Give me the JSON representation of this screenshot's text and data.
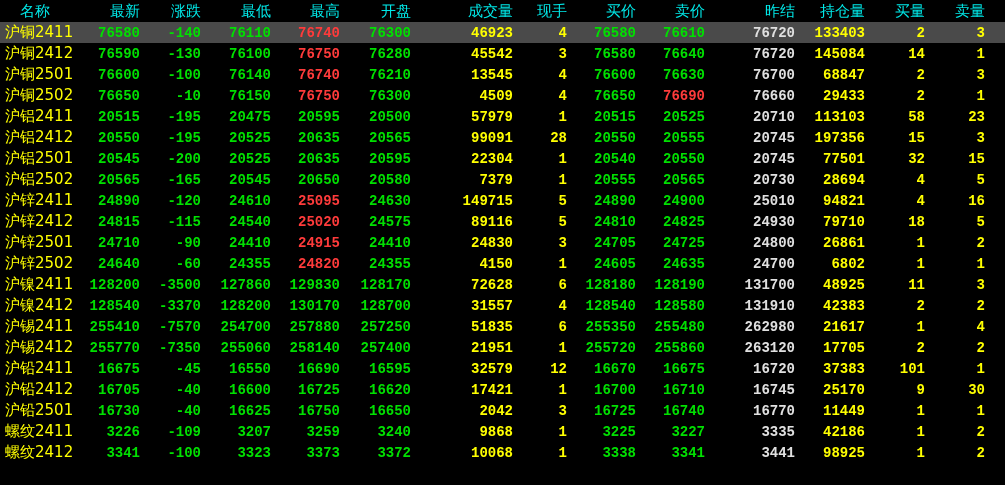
{
  "table": {
    "columns": [
      {
        "label": "名称",
        "kind": "name"
      },
      {
        "label": "最新",
        "kind": "price"
      },
      {
        "label": "涨跌",
        "kind": "price"
      },
      {
        "label": "最低",
        "kind": "price"
      },
      {
        "label": "最高",
        "kind": "price"
      },
      {
        "label": "开盘",
        "kind": "price"
      },
      {
        "label": "成交量",
        "kind": "volume"
      },
      {
        "label": "现手",
        "kind": "volume"
      },
      {
        "label": "买价",
        "kind": "price"
      },
      {
        "label": "卖价",
        "kind": "price"
      },
      {
        "label": "昨结",
        "kind": "settle"
      },
      {
        "label": "持仓量",
        "kind": "volume"
      },
      {
        "label": "买量",
        "kind": "volume"
      },
      {
        "label": "卖量",
        "kind": "volume"
      }
    ],
    "rows": [
      {
        "selected": true,
        "cells": [
          "沪铜2411",
          {
            "text": "76580",
            "color": "#00e000"
          },
          {
            "text": "-140",
            "color": "#00e000"
          },
          {
            "text": "76110",
            "color": "#00e000"
          },
          {
            "text": "76740",
            "color": "#ff3b3b"
          },
          {
            "text": "76300",
            "color": "#00e000"
          },
          "46923",
          "4",
          {
            "text": "76580",
            "color": "#00e000"
          },
          {
            "text": "76610",
            "color": "#00e000"
          },
          "76720",
          "133403",
          "2",
          "3"
        ]
      },
      {
        "selected": false,
        "cells": [
          "沪铜2412",
          {
            "text": "76590",
            "color": "#00e000"
          },
          {
            "text": "-130",
            "color": "#00e000"
          },
          {
            "text": "76100",
            "color": "#00e000"
          },
          {
            "text": "76750",
            "color": "#ff3b3b"
          },
          {
            "text": "76280",
            "color": "#00e000"
          },
          "45542",
          "3",
          {
            "text": "76580",
            "color": "#00e000"
          },
          {
            "text": "76640",
            "color": "#00e000"
          },
          "76720",
          "145084",
          "14",
          "1"
        ]
      },
      {
        "selected": false,
        "cells": [
          "沪铜2501",
          {
            "text": "76600",
            "color": "#00e000"
          },
          {
            "text": "-100",
            "color": "#00e000"
          },
          {
            "text": "76140",
            "color": "#00e000"
          },
          {
            "text": "76740",
            "color": "#ff3b3b"
          },
          {
            "text": "76210",
            "color": "#00e000"
          },
          "13545",
          "4",
          {
            "text": "76600",
            "color": "#00e000"
          },
          {
            "text": "76630",
            "color": "#00e000"
          },
          "76700",
          "68847",
          "2",
          "3"
        ]
      },
      {
        "selected": false,
        "cells": [
          "沪铜2502",
          {
            "text": "76650",
            "color": "#00e000"
          },
          {
            "text": "-10",
            "color": "#00e000"
          },
          {
            "text": "76150",
            "color": "#00e000"
          },
          {
            "text": "76750",
            "color": "#ff3b3b"
          },
          {
            "text": "76300",
            "color": "#00e000"
          },
          "4509",
          "4",
          {
            "text": "76650",
            "color": "#00e000"
          },
          {
            "text": "76690",
            "color": "#ff3b3b"
          },
          "76660",
          "29433",
          "2",
          "1"
        ]
      },
      {
        "selected": false,
        "cells": [
          "沪铝2411",
          {
            "text": "20515",
            "color": "#00e000"
          },
          {
            "text": "-195",
            "color": "#00e000"
          },
          {
            "text": "20475",
            "color": "#00e000"
          },
          {
            "text": "20595",
            "color": "#00e000"
          },
          {
            "text": "20500",
            "color": "#00e000"
          },
          "57979",
          "1",
          {
            "text": "20515",
            "color": "#00e000"
          },
          {
            "text": "20525",
            "color": "#00e000"
          },
          "20710",
          "113103",
          "58",
          "23"
        ]
      },
      {
        "selected": false,
        "cells": [
          "沪铝2412",
          {
            "text": "20550",
            "color": "#00e000"
          },
          {
            "text": "-195",
            "color": "#00e000"
          },
          {
            "text": "20525",
            "color": "#00e000"
          },
          {
            "text": "20635",
            "color": "#00e000"
          },
          {
            "text": "20565",
            "color": "#00e000"
          },
          "99091",
          "28",
          {
            "text": "20550",
            "color": "#00e000"
          },
          {
            "text": "20555",
            "color": "#00e000"
          },
          "20745",
          "197356",
          "15",
          "3"
        ]
      },
      {
        "selected": false,
        "cells": [
          "沪铝2501",
          {
            "text": "20545",
            "color": "#00e000"
          },
          {
            "text": "-200",
            "color": "#00e000"
          },
          {
            "text": "20525",
            "color": "#00e000"
          },
          {
            "text": "20635",
            "color": "#00e000"
          },
          {
            "text": "20595",
            "color": "#00e000"
          },
          "22304",
          "1",
          {
            "text": "20540",
            "color": "#00e000"
          },
          {
            "text": "20550",
            "color": "#00e000"
          },
          "20745",
          "77501",
          "32",
          "15"
        ]
      },
      {
        "selected": false,
        "cells": [
          "沪铝2502",
          {
            "text": "20565",
            "color": "#00e000"
          },
          {
            "text": "-165",
            "color": "#00e000"
          },
          {
            "text": "20545",
            "color": "#00e000"
          },
          {
            "text": "20650",
            "color": "#00e000"
          },
          {
            "text": "20580",
            "color": "#00e000"
          },
          "7379",
          "1",
          {
            "text": "20555",
            "color": "#00e000"
          },
          {
            "text": "20565",
            "color": "#00e000"
          },
          "20730",
          "28694",
          "4",
          "5"
        ]
      },
      {
        "selected": false,
        "cells": [
          "沪锌2411",
          {
            "text": "24890",
            "color": "#00e000"
          },
          {
            "text": "-120",
            "color": "#00e000"
          },
          {
            "text": "24610",
            "color": "#00e000"
          },
          {
            "text": "25095",
            "color": "#ff3b3b"
          },
          {
            "text": "24630",
            "color": "#00e000"
          },
          "149715",
          "5",
          {
            "text": "24890",
            "color": "#00e000"
          },
          {
            "text": "24900",
            "color": "#00e000"
          },
          "25010",
          "94821",
          "4",
          "16"
        ]
      },
      {
        "selected": false,
        "cells": [
          "沪锌2412",
          {
            "text": "24815",
            "color": "#00e000"
          },
          {
            "text": "-115",
            "color": "#00e000"
          },
          {
            "text": "24540",
            "color": "#00e000"
          },
          {
            "text": "25020",
            "color": "#ff3b3b"
          },
          {
            "text": "24575",
            "color": "#00e000"
          },
          "89116",
          "5",
          {
            "text": "24810",
            "color": "#00e000"
          },
          {
            "text": "24825",
            "color": "#00e000"
          },
          "24930",
          "79710",
          "18",
          "5"
        ]
      },
      {
        "selected": false,
        "cells": [
          "沪锌2501",
          {
            "text": "24710",
            "color": "#00e000"
          },
          {
            "text": "-90",
            "color": "#00e000"
          },
          {
            "text": "24410",
            "color": "#00e000"
          },
          {
            "text": "24915",
            "color": "#ff3b3b"
          },
          {
            "text": "24410",
            "color": "#00e000"
          },
          "24830",
          "3",
          {
            "text": "24705",
            "color": "#00e000"
          },
          {
            "text": "24725",
            "color": "#00e000"
          },
          "24800",
          "26861",
          "1",
          "2"
        ]
      },
      {
        "selected": false,
        "cells": [
          "沪锌2502",
          {
            "text": "24640",
            "color": "#00e000"
          },
          {
            "text": "-60",
            "color": "#00e000"
          },
          {
            "text": "24355",
            "color": "#00e000"
          },
          {
            "text": "24820",
            "color": "#ff3b3b"
          },
          {
            "text": "24355",
            "color": "#00e000"
          },
          "4150",
          "1",
          {
            "text": "24605",
            "color": "#00e000"
          },
          {
            "text": "24635",
            "color": "#00e000"
          },
          "24700",
          "6802",
          "1",
          "1"
        ]
      },
      {
        "selected": false,
        "cells": [
          "沪镍2411",
          {
            "text": "128200",
            "color": "#00e000"
          },
          {
            "text": "-3500",
            "color": "#00e000"
          },
          {
            "text": "127860",
            "color": "#00e000"
          },
          {
            "text": "129830",
            "color": "#00e000"
          },
          {
            "text": "128170",
            "color": "#00e000"
          },
          "72628",
          "6",
          {
            "text": "128180",
            "color": "#00e000"
          },
          {
            "text": "128190",
            "color": "#00e000"
          },
          "131700",
          "48925",
          "11",
          "3"
        ]
      },
      {
        "selected": false,
        "cells": [
          "沪镍2412",
          {
            "text": "128540",
            "color": "#00e000"
          },
          {
            "text": "-3370",
            "color": "#00e000"
          },
          {
            "text": "128200",
            "color": "#00e000"
          },
          {
            "text": "130170",
            "color": "#00e000"
          },
          {
            "text": "128700",
            "color": "#00e000"
          },
          "31557",
          "4",
          {
            "text": "128540",
            "color": "#00e000"
          },
          {
            "text": "128580",
            "color": "#00e000"
          },
          "131910",
          "42383",
          "2",
          "2"
        ]
      },
      {
        "selected": false,
        "cells": [
          "沪锡2411",
          {
            "text": "255410",
            "color": "#00e000"
          },
          {
            "text": "-7570",
            "color": "#00e000"
          },
          {
            "text": "254700",
            "color": "#00e000"
          },
          {
            "text": "257880",
            "color": "#00e000"
          },
          {
            "text": "257250",
            "color": "#00e000"
          },
          "51835",
          "6",
          {
            "text": "255350",
            "color": "#00e000"
          },
          {
            "text": "255480",
            "color": "#00e000"
          },
          "262980",
          "21617",
          "1",
          "4"
        ]
      },
      {
        "selected": false,
        "cells": [
          "沪锡2412",
          {
            "text": "255770",
            "color": "#00e000"
          },
          {
            "text": "-7350",
            "color": "#00e000"
          },
          {
            "text": "255060",
            "color": "#00e000"
          },
          {
            "text": "258140",
            "color": "#00e000"
          },
          {
            "text": "257400",
            "color": "#00e000"
          },
          "21951",
          "1",
          {
            "text": "255720",
            "color": "#00e000"
          },
          {
            "text": "255860",
            "color": "#00e000"
          },
          "263120",
          "17705",
          "2",
          "2"
        ]
      },
      {
        "selected": false,
        "cells": [
          "沪铅2411",
          {
            "text": "16675",
            "color": "#00e000"
          },
          {
            "text": "-45",
            "color": "#00e000"
          },
          {
            "text": "16550",
            "color": "#00e000"
          },
          {
            "text": "16690",
            "color": "#00e000"
          },
          {
            "text": "16595",
            "color": "#00e000"
          },
          "32579",
          "12",
          {
            "text": "16670",
            "color": "#00e000"
          },
          {
            "text": "16675",
            "color": "#00e000"
          },
          "16720",
          "37383",
          "101",
          "1"
        ]
      },
      {
        "selected": false,
        "cells": [
          "沪铅2412",
          {
            "text": "16705",
            "color": "#00e000"
          },
          {
            "text": "-40",
            "color": "#00e000"
          },
          {
            "text": "16600",
            "color": "#00e000"
          },
          {
            "text": "16725",
            "color": "#00e000"
          },
          {
            "text": "16620",
            "color": "#00e000"
          },
          "17421",
          "1",
          {
            "text": "16700",
            "color": "#00e000"
          },
          {
            "text": "16710",
            "color": "#00e000"
          },
          "16745",
          "25170",
          "9",
          "30"
        ]
      },
      {
        "selected": false,
        "cells": [
          "沪铅2501",
          {
            "text": "16730",
            "color": "#00e000"
          },
          {
            "text": "-40",
            "color": "#00e000"
          },
          {
            "text": "16625",
            "color": "#00e000"
          },
          {
            "text": "16750",
            "color": "#00e000"
          },
          {
            "text": "16650",
            "color": "#00e000"
          },
          "2042",
          "3",
          {
            "text": "16725",
            "color": "#00e000"
          },
          {
            "text": "16740",
            "color": "#00e000"
          },
          "16770",
          "11449",
          "1",
          "1"
        ]
      },
      {
        "selected": false,
        "cells": [
          "螺纹2411",
          {
            "text": "3226",
            "color": "#00e000"
          },
          {
            "text": "-109",
            "color": "#00e000"
          },
          {
            "text": "3207",
            "color": "#00e000"
          },
          {
            "text": "3259",
            "color": "#00e000"
          },
          {
            "text": "3240",
            "color": "#00e000"
          },
          "9868",
          "1",
          {
            "text": "3225",
            "color": "#00e000"
          },
          {
            "text": "3227",
            "color": "#00e000"
          },
          "3335",
          "42186",
          "1",
          "2"
        ]
      },
      {
        "selected": false,
        "cells": [
          "螺纹2412",
          {
            "text": "3341",
            "color": "#00e000"
          },
          {
            "text": "-100",
            "color": "#00e000"
          },
          {
            "text": "3323",
            "color": "#00e000"
          },
          {
            "text": "3373",
            "color": "#00e000"
          },
          {
            "text": "3372",
            "color": "#00e000"
          },
          "10068",
          "1",
          {
            "text": "3338",
            "color": "#00e000"
          },
          {
            "text": "3341",
            "color": "#00e000"
          },
          "3441",
          "98925",
          "1",
          "2"
        ]
      }
    ]
  }
}
